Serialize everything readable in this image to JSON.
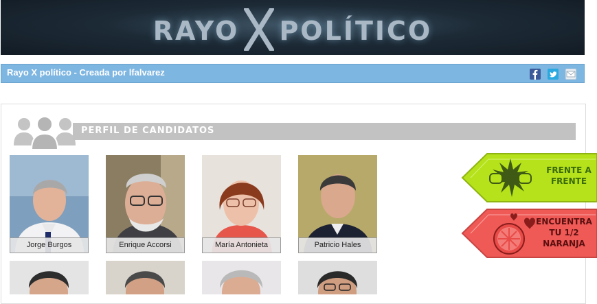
{
  "header": {
    "logo_left": "RAYO",
    "logo_right": "POLÍTICO"
  },
  "titlebar": {
    "title": "Rayo X político - Creada por lfalvarez"
  },
  "section": {
    "title": "PERFIL DE CANDIDATOS"
  },
  "candidates": [
    {
      "name": "Jorge Burgos"
    },
    {
      "name": "Enrique Accorsi"
    },
    {
      "name": "María Antonieta"
    },
    {
      "name": "Patricio Hales"
    }
  ],
  "side": {
    "frente_line1": "FRENTE A",
    "frente_line2": "FRENTE",
    "naranja_line1": "ENCUENTRA",
    "naranja_line2": "TU 1/2",
    "naranja_line3": "NARANJA"
  },
  "colors": {
    "titlebar": "#7eb6e2",
    "frente": "#b5e21a",
    "naranja": "#ef5a57"
  },
  "icons": [
    "facebook-icon",
    "twitter-icon",
    "mail-icon",
    "people-icon",
    "boxing-gloves-icon",
    "orange-heart-icon"
  ]
}
